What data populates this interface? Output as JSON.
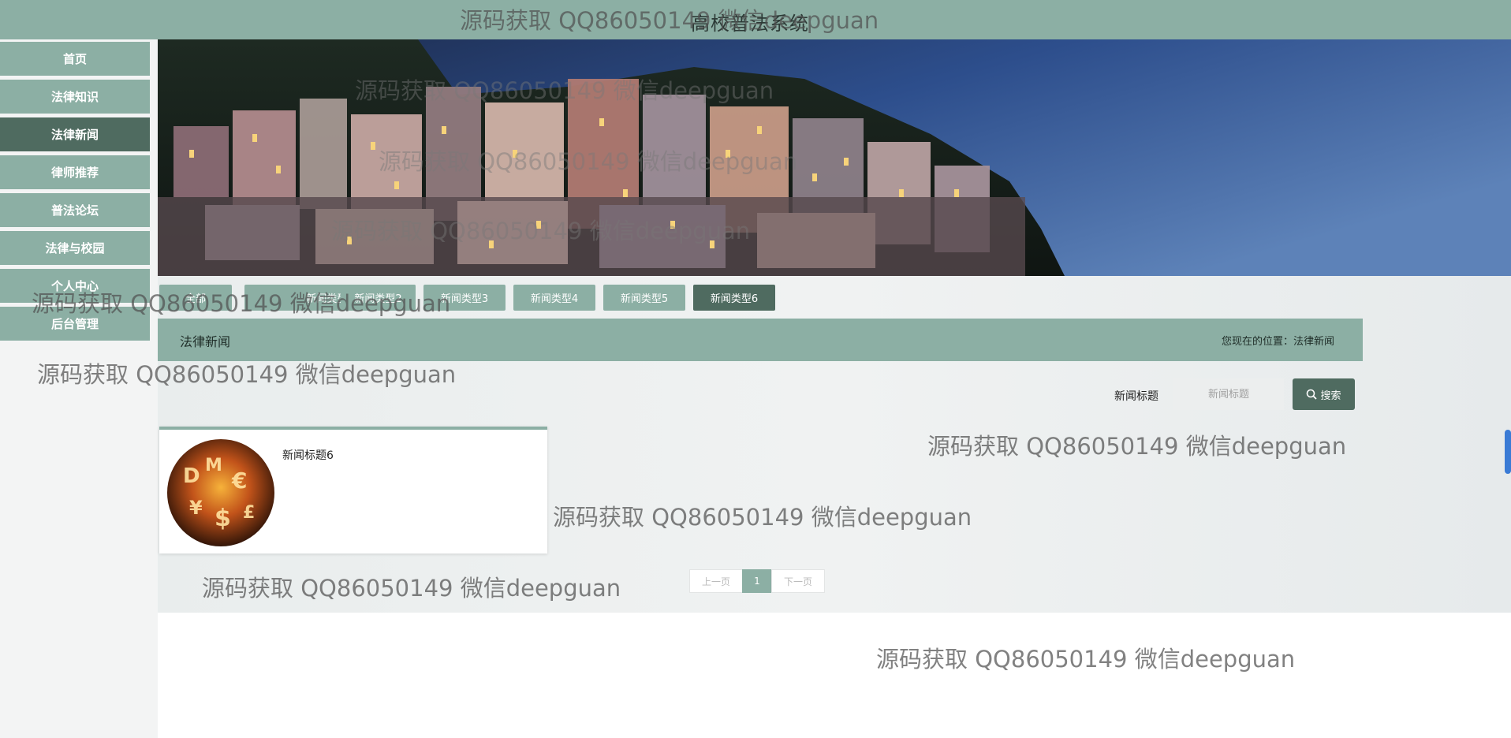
{
  "header": {
    "site_title": "高校普法系统"
  },
  "sidebar": {
    "items": [
      {
        "label": "首页"
      },
      {
        "label": "法律知识"
      },
      {
        "label": "法律新闻"
      },
      {
        "label": "律师推荐"
      },
      {
        "label": "普法论坛"
      },
      {
        "label": "法律与校园"
      },
      {
        "label": "个人中心"
      },
      {
        "label": "后台管理"
      }
    ],
    "active_index": 2
  },
  "categories": {
    "tabs": [
      {
        "label": "全部"
      },
      {
        "label": "新闻类型1"
      },
      {
        "label": "新闻类型2"
      },
      {
        "label": "新闻类型3"
      },
      {
        "label": "新闻类型4"
      },
      {
        "label": "新闻类型5"
      },
      {
        "label": "新闻类型6"
      }
    ],
    "active_index": 6
  },
  "section": {
    "title": "法律新闻",
    "breadcrumb": "您现在的位置：法律新闻"
  },
  "search": {
    "label": "新闻标题",
    "placeholder": "新闻标题",
    "button_label": "搜索"
  },
  "news": [
    {
      "title": "新闻标题6"
    }
  ],
  "pagination": {
    "prev_label": "上一页",
    "current_page": "1",
    "next_label": "下一页"
  },
  "watermark": {
    "text": "源码获取 QQ86050149 微信deepguan"
  },
  "colors": {
    "primary": "#8cafa4",
    "active": "#4f6b60"
  }
}
